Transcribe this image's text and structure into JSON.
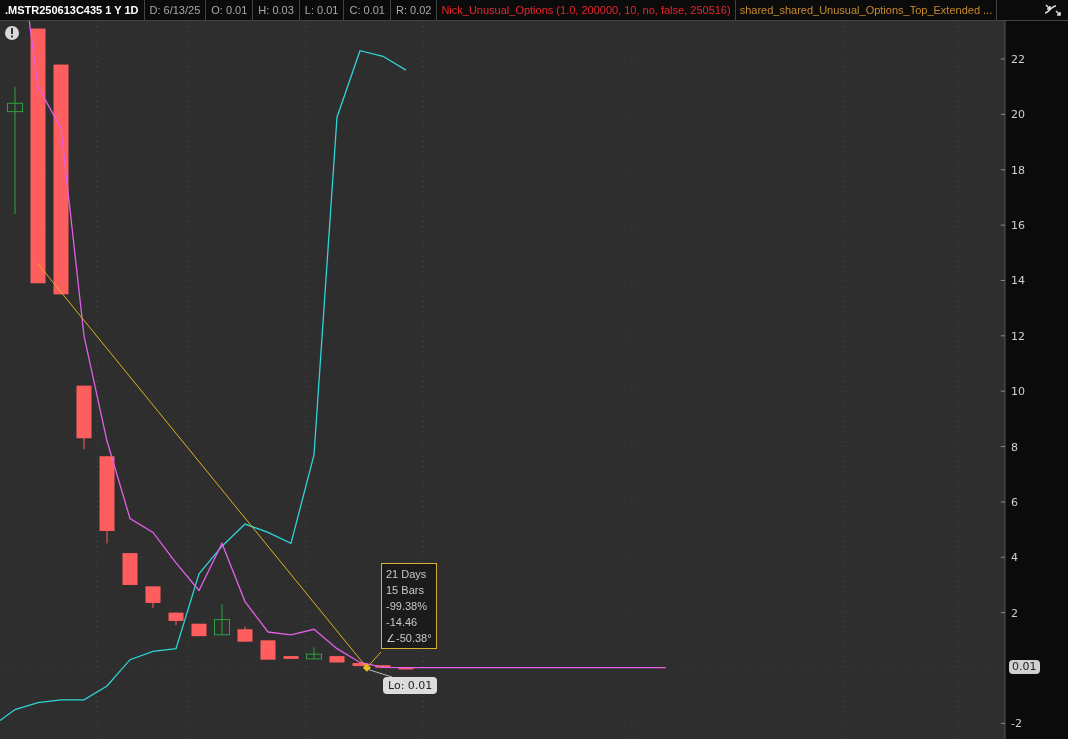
{
  "header": {
    "symbol": ".MSTR250613C435 1 Y 1D",
    "fields": [
      "D: 6/13/25",
      "O: 0.01",
      "H: 0.03",
      "L: 0.01",
      "C: 0.01",
      "R: 0.02"
    ],
    "studies": [
      {
        "label": "Nick_Unusual_Options (1.0, 200000, 10, no, false, 250516)",
        "color": "#e8262b"
      },
      {
        "label": "shared_shared_Unusual_Options_Top_Extended ...",
        "color": "#c88a2e"
      }
    ]
  },
  "chart": {
    "y_axis_labels": [
      "22",
      "20",
      "18",
      "16",
      "14",
      "12",
      "10",
      "8",
      "6",
      "4",
      "2",
      "-2"
    ],
    "trendline_tooltip": [
      "21 Days",
      "15 Bars",
      "-99.38%",
      "-14.46",
      "∠-50.38°"
    ],
    "low_label": "Lo: 0.01",
    "last_price": "0.01"
  }
}
